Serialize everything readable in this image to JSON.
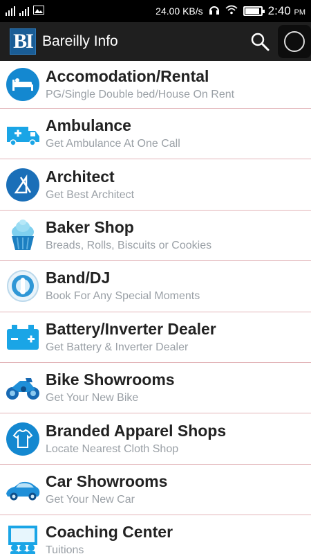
{
  "status_bar": {
    "network_speed": "24.00 KB/s",
    "time": "2:40",
    "ampm": "PM"
  },
  "app_bar": {
    "logo_text": "BI",
    "title": "Bareilly Info",
    "icons": [
      "search-icon",
      "circle-icon"
    ]
  },
  "colors": {
    "app_bar": "#1f1f1f",
    "logo": "#1a5d96",
    "icon_blue": "#1488d0",
    "divider": "#e2b3b8",
    "subtitle": "#9aa0a6"
  },
  "categories": [
    {
      "title": "Accomodation/Rental",
      "subtitle": "PG/Single Double bed/House On Rent",
      "icon": "bed-icon"
    },
    {
      "title": "Ambulance",
      "subtitle": "Get Ambulance At One Call",
      "icon": "ambulance-icon"
    },
    {
      "title": "Architect",
      "subtitle": "Get Best Architect",
      "icon": "architect-icon"
    },
    {
      "title": "Baker Shop",
      "subtitle": "Breads, Rolls, Biscuits or Cookies",
      "icon": "cupcake-icon"
    },
    {
      "title": "Band/DJ",
      "subtitle": "Book For Any Special Moments",
      "icon": "tuba-icon"
    },
    {
      "title": "Battery/Inverter Dealer",
      "subtitle": "Get Battery & Inverter Dealer",
      "icon": "battery-icon"
    },
    {
      "title": "Bike Showrooms",
      "subtitle": "Get Your New Bike",
      "icon": "motorbike-icon"
    },
    {
      "title": "Branded Apparel Shops",
      "subtitle": "Locate Nearest Cloth Shop",
      "icon": "tshirt-icon"
    },
    {
      "title": "Car Showrooms",
      "subtitle": "Get Your New Car",
      "icon": "car-icon"
    },
    {
      "title": "Coaching Center",
      "subtitle": "Tuitions",
      "icon": "classroom-icon"
    }
  ]
}
